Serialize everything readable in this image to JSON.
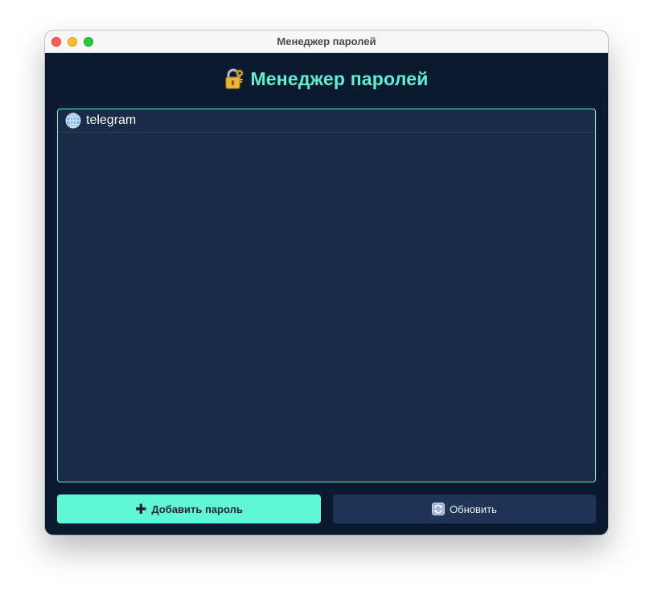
{
  "window": {
    "title": "Менеджер паролей"
  },
  "header": {
    "icon": "locked-with-key-icon",
    "title": "Менеджер паролей"
  },
  "password_list": {
    "items": [
      {
        "icon": "globe-icon",
        "label": "telegram"
      }
    ]
  },
  "buttons": {
    "add": {
      "icon": "plus-icon",
      "label": "Добавить пароль"
    },
    "refresh": {
      "icon": "refresh-icon",
      "label": "Обновить"
    }
  },
  "colors": {
    "background": "#0b1931",
    "panel": "#182b47",
    "accent": "#5ef2cf",
    "secondary_button": "#1e3555"
  }
}
